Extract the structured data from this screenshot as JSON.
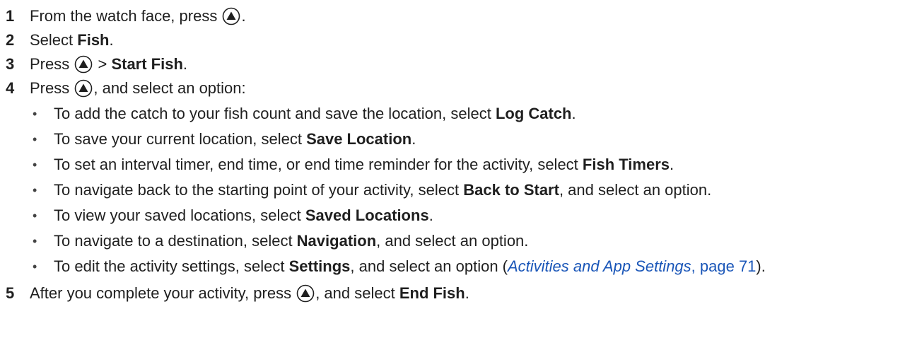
{
  "steps": [
    {
      "num": "1",
      "pre": "From the watch face, press ",
      "post": "."
    },
    {
      "num": "2",
      "pre": "Select ",
      "bold": "Fish",
      "post": "."
    },
    {
      "num": "3",
      "pre": "Press ",
      "mid": " > ",
      "bold": "Start Fish",
      "post": "."
    },
    {
      "num": "4",
      "pre": "Press ",
      "post": ", and select an option:"
    },
    {
      "num": "5",
      "pre": "After you complete your activity, press ",
      "mid": ", and select ",
      "bold": "End Fish",
      "post": "."
    }
  ],
  "bullets": [
    {
      "pre": "To add the catch to your fish count and save the location, select ",
      "bold": "Log Catch",
      "post": "."
    },
    {
      "pre": "To save your current location, select ",
      "bold": "Save Location",
      "post": "."
    },
    {
      "pre": "To set an interval timer, end time, or end time reminder for the activity, select ",
      "bold": "Fish Timers",
      "post": "."
    },
    {
      "pre": "To navigate back to the starting point of your activity, select ",
      "bold": "Back to Start",
      "post": ", and select an option."
    },
    {
      "pre": "To view your saved locations, select ",
      "bold": "Saved Locations",
      "post": "."
    },
    {
      "pre": "To navigate to a destination, select ",
      "bold": "Navigation",
      "post": ", and select an option."
    },
    {
      "pre": "To edit the activity settings, select ",
      "bold": "Settings",
      "mid": ", and select an option (",
      "link_italic": "Activities and App Settings",
      "link_page": ", page 71",
      "post": ")."
    }
  ],
  "bullet_glyph": "•",
  "icon": "up-button-icon"
}
